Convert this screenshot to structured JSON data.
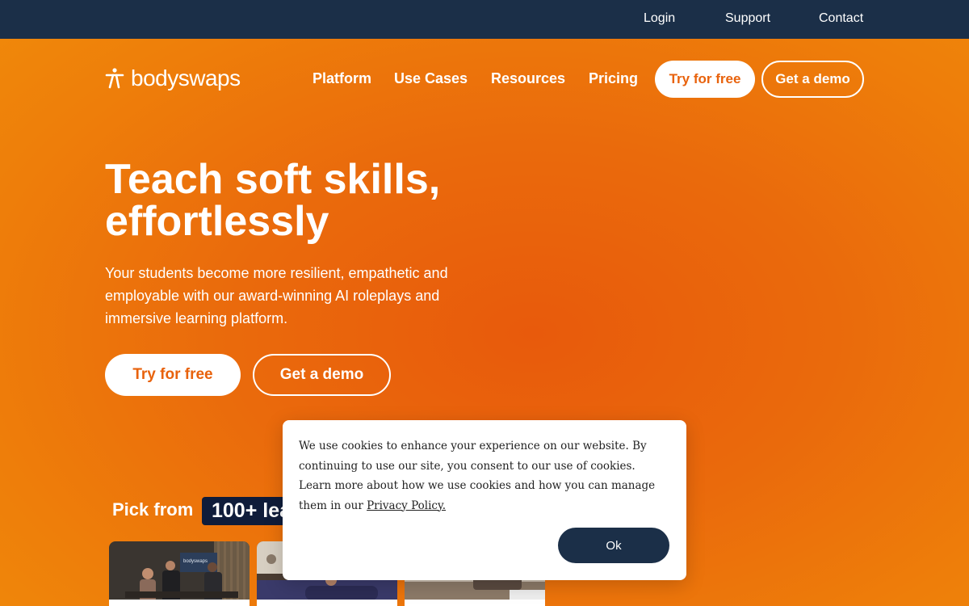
{
  "topbar": {
    "login": "Login",
    "support": "Support",
    "contact": "Contact"
  },
  "nav": {
    "logo_text": "bodyswaps",
    "links": [
      "Platform",
      "Use Cases",
      "Resources",
      "Pricing"
    ],
    "try_free": "Try for free",
    "get_demo": "Get a demo"
  },
  "hero": {
    "title_line1": "Teach soft skills,",
    "title_line2": "effortlessly",
    "subtitle": "Your students become more resilient, empathetic and employable with our award-winning AI roleplays and immersive learning platform.",
    "try_free": "Try for free",
    "get_demo": "Get a demo"
  },
  "pick": {
    "label": "Pick from",
    "badge": "100+ lea"
  },
  "thumbnails": [
    {
      "icon": "office-scene-image",
      "screen_text": "bodyswaps"
    },
    {
      "icon": "sofa-scene-image"
    },
    {
      "icon": "room-scene-image"
    }
  ],
  "cookie": {
    "text": "We use cookies to enhance your experience on our website. By continuing to use our site, you consent to our use of cookies. Learn more about how we use cookies and how you can manage them in our ",
    "link": "Privacy Policy.",
    "ok": "Ok"
  },
  "colors": {
    "topbar": "#1b2f48",
    "accent_orange": "#e8620c",
    "badge_navy": "#0f1c3a"
  }
}
